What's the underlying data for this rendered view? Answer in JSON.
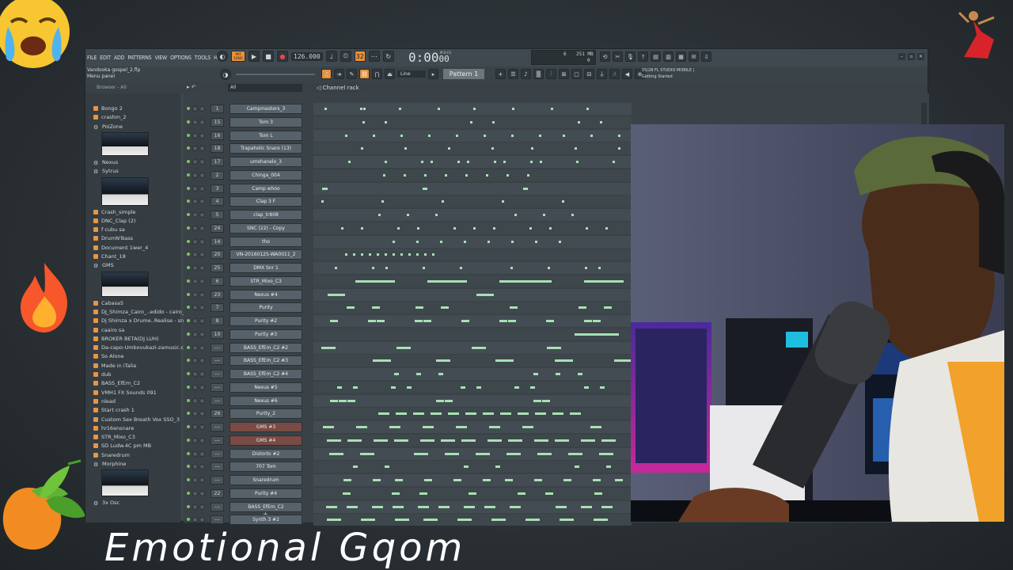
{
  "menu": {
    "items": [
      "FILE",
      "EDIT",
      "ADD",
      "PATTERNS",
      "VIEW",
      "OPTIONS",
      "TOOLS",
      "HELP"
    ]
  },
  "transport": {
    "pat_label": "PAT",
    "song_label": "SONG",
    "bpm": "126.000",
    "time": "0:00",
    "time_frac": "00",
    "time_unit": "M:S:CS",
    "cpu_value": "6",
    "memory": "251 MB",
    "poly": "0"
  },
  "project": {
    "file": "Vandooka gospel_2.flp",
    "hint": "Menu panel"
  },
  "toolbar2": {
    "snap": "Line",
    "pattern": "Pattern 1"
  },
  "news": {
    "date": "05/28",
    "headline": "FL STUDIO MOBILE |",
    "sub": "Getting Started"
  },
  "browser": {
    "header": "Browser - All",
    "items": [
      {
        "label": "Bongo 2",
        "icon": "folder-icon"
      },
      {
        "label": "crashm_2",
        "icon": "folder-icon"
      },
      {
        "label": "PoiZone",
        "icon": "plugin-icon"
      },
      {
        "label": "Nexus",
        "icon": "plugin-icon"
      },
      {
        "label": "Sytrus",
        "icon": "plugin-icon"
      },
      {
        "label": "Crash_simple",
        "icon": "folder-icon"
      },
      {
        "label": "DNC_Clap (2)",
        "icon": "folder-icon"
      },
      {
        "label": "f cubu sa",
        "icon": "folder-icon"
      },
      {
        "label": "DrumN'Bass",
        "icon": "folder-icon"
      },
      {
        "label": "Document 1wer_4",
        "icon": "folder-icon"
      },
      {
        "label": "Chant_18",
        "icon": "folder-icon"
      },
      {
        "label": "GMS",
        "icon": "plugin-icon"
      },
      {
        "label": "Cabasa5",
        "icon": "folder-icon"
      },
      {
        "label": "DJ_Shimza_Cairo_..edido - cairo_2",
        "icon": "folder-icon"
      },
      {
        "label": "Dj Shimza x Drume..Realise - snr 67",
        "icon": "folder-icon"
      },
      {
        "label": "caairo sa",
        "icon": "folder-icon"
      },
      {
        "label": "BROKER BETA(DJ LUH)",
        "icon": "folder-icon"
      },
      {
        "label": "Da-capo-Umbovukazi-zamusic.co-_5",
        "icon": "folder-icon"
      },
      {
        "label": "So Alone",
        "icon": "folder-icon"
      },
      {
        "label": "Made in iTalia",
        "icon": "folder-icon"
      },
      {
        "label": "dub",
        "icon": "folder-icon"
      },
      {
        "label": "BASS_EfEm_C2",
        "icon": "folder-icon"
      },
      {
        "label": "VMH1 FX Sounds 091",
        "icon": "folder-icon"
      },
      {
        "label": "nlead",
        "icon": "folder-icon"
      },
      {
        "label": "Start crash 1",
        "icon": "folder-icon"
      },
      {
        "label": "Custom Sex Breath Vox SSO_3",
        "icon": "folder-icon"
      },
      {
        "label": "hr16ensnare",
        "icon": "folder-icon"
      },
      {
        "label": "STR_Mixo_C3",
        "icon": "folder-icon"
      },
      {
        "label": "SD Ludw.4C pm     MB",
        "icon": "folder-icon"
      },
      {
        "label": "Snaredrum",
        "icon": "folder-icon"
      },
      {
        "label": "Morphine",
        "icon": "plugin-icon"
      },
      {
        "label": "3x Osc",
        "icon": "plugin-icon"
      }
    ]
  },
  "rack": {
    "title": "Channel rack",
    "filter": "All",
    "add": "+",
    "channels": [
      {
        "mix": "1",
        "name": "Campmasters_3"
      },
      {
        "mix": "15",
        "name": "Tom 3"
      },
      {
        "mix": "16",
        "name": "Tom L"
      },
      {
        "mix": "18",
        "name": "Trapaholic Snare (13)"
      },
      {
        "mix": "17",
        "name": "umshanelo_3"
      },
      {
        "mix": "2",
        "name": "Chinga_004"
      },
      {
        "mix": "3",
        "name": "Camp whoo"
      },
      {
        "mix": "4",
        "name": "Clap 3 F"
      },
      {
        "mix": "5",
        "name": "clap_tr808"
      },
      {
        "mix": "24",
        "name": "SNC (22) - Copy"
      },
      {
        "mix": "14",
        "name": "tho"
      },
      {
        "mix": "20",
        "name": "VN-20160125-WA0011_2"
      },
      {
        "mix": "25",
        "name": "DMX Snr 1"
      },
      {
        "mix": "6",
        "name": "STR_Mixo_C3"
      },
      {
        "mix": "23",
        "name": "Nexus #4"
      },
      {
        "mix": "7",
        "name": "Purity"
      },
      {
        "mix": "8",
        "name": "Purity #2"
      },
      {
        "mix": "10",
        "name": "Purity #3"
      },
      {
        "mix": "---",
        "name": "BASS_EfEm_C2 #2"
      },
      {
        "mix": "---",
        "name": "BASS_EfEm_C2 #3"
      },
      {
        "mix": "---",
        "name": "BASS_EfEm_C2 #4"
      },
      {
        "mix": "---",
        "name": "Nexus #5"
      },
      {
        "mix": "---",
        "name": "Nexus #6"
      },
      {
        "mix": "26",
        "name": "Purity_2"
      },
      {
        "mix": "---",
        "name": "GMS #3"
      },
      {
        "mix": "---",
        "name": "GMS #4"
      },
      {
        "mix": "---",
        "name": "Distorto #2"
      },
      {
        "mix": "---",
        "name": "707 Tom"
      },
      {
        "mix": "---",
        "name": "Snaredrum"
      },
      {
        "mix": "22",
        "name": "Purity #4"
      },
      {
        "mix": "---",
        "name": "BASS_EfEm_C2"
      },
      {
        "mix": "---",
        "name": "Synth 3 #2"
      }
    ]
  },
  "overlay": {
    "title": "Emotional Gqom"
  },
  "colors": {
    "accent": "#e7913b",
    "step_on": "#a8e0b4",
    "led": "#7fc45a"
  }
}
